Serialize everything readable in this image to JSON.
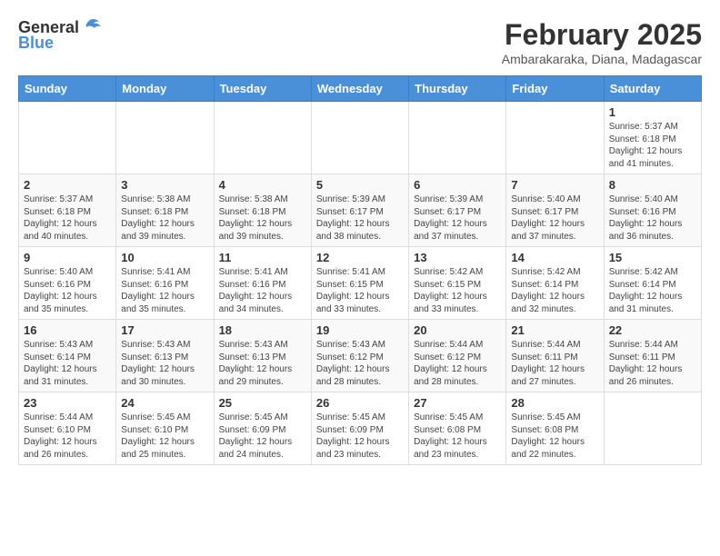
{
  "header": {
    "logo_general": "General",
    "logo_blue": "Blue",
    "month_title": "February 2025",
    "location": "Ambarakaraka, Diana, Madagascar"
  },
  "weekdays": [
    "Sunday",
    "Monday",
    "Tuesday",
    "Wednesday",
    "Thursday",
    "Friday",
    "Saturday"
  ],
  "weeks": [
    {
      "days": [
        {
          "num": "",
          "info": ""
        },
        {
          "num": "",
          "info": ""
        },
        {
          "num": "",
          "info": ""
        },
        {
          "num": "",
          "info": ""
        },
        {
          "num": "",
          "info": ""
        },
        {
          "num": "",
          "info": ""
        },
        {
          "num": "1",
          "info": "Sunrise: 5:37 AM\nSunset: 6:18 PM\nDaylight: 12 hours\nand 41 minutes."
        }
      ]
    },
    {
      "days": [
        {
          "num": "2",
          "info": "Sunrise: 5:37 AM\nSunset: 6:18 PM\nDaylight: 12 hours\nand 40 minutes."
        },
        {
          "num": "3",
          "info": "Sunrise: 5:38 AM\nSunset: 6:18 PM\nDaylight: 12 hours\nand 39 minutes."
        },
        {
          "num": "4",
          "info": "Sunrise: 5:38 AM\nSunset: 6:18 PM\nDaylight: 12 hours\nand 39 minutes."
        },
        {
          "num": "5",
          "info": "Sunrise: 5:39 AM\nSunset: 6:17 PM\nDaylight: 12 hours\nand 38 minutes."
        },
        {
          "num": "6",
          "info": "Sunrise: 5:39 AM\nSunset: 6:17 PM\nDaylight: 12 hours\nand 37 minutes."
        },
        {
          "num": "7",
          "info": "Sunrise: 5:40 AM\nSunset: 6:17 PM\nDaylight: 12 hours\nand 37 minutes."
        },
        {
          "num": "8",
          "info": "Sunrise: 5:40 AM\nSunset: 6:16 PM\nDaylight: 12 hours\nand 36 minutes."
        }
      ]
    },
    {
      "days": [
        {
          "num": "9",
          "info": "Sunrise: 5:40 AM\nSunset: 6:16 PM\nDaylight: 12 hours\nand 35 minutes."
        },
        {
          "num": "10",
          "info": "Sunrise: 5:41 AM\nSunset: 6:16 PM\nDaylight: 12 hours\nand 35 minutes."
        },
        {
          "num": "11",
          "info": "Sunrise: 5:41 AM\nSunset: 6:16 PM\nDaylight: 12 hours\nand 34 minutes."
        },
        {
          "num": "12",
          "info": "Sunrise: 5:41 AM\nSunset: 6:15 PM\nDaylight: 12 hours\nand 33 minutes."
        },
        {
          "num": "13",
          "info": "Sunrise: 5:42 AM\nSunset: 6:15 PM\nDaylight: 12 hours\nand 33 minutes."
        },
        {
          "num": "14",
          "info": "Sunrise: 5:42 AM\nSunset: 6:14 PM\nDaylight: 12 hours\nand 32 minutes."
        },
        {
          "num": "15",
          "info": "Sunrise: 5:42 AM\nSunset: 6:14 PM\nDaylight: 12 hours\nand 31 minutes."
        }
      ]
    },
    {
      "days": [
        {
          "num": "16",
          "info": "Sunrise: 5:43 AM\nSunset: 6:14 PM\nDaylight: 12 hours\nand 31 minutes."
        },
        {
          "num": "17",
          "info": "Sunrise: 5:43 AM\nSunset: 6:13 PM\nDaylight: 12 hours\nand 30 minutes."
        },
        {
          "num": "18",
          "info": "Sunrise: 5:43 AM\nSunset: 6:13 PM\nDaylight: 12 hours\nand 29 minutes."
        },
        {
          "num": "19",
          "info": "Sunrise: 5:43 AM\nSunset: 6:12 PM\nDaylight: 12 hours\nand 28 minutes."
        },
        {
          "num": "20",
          "info": "Sunrise: 5:44 AM\nSunset: 6:12 PM\nDaylight: 12 hours\nand 28 minutes."
        },
        {
          "num": "21",
          "info": "Sunrise: 5:44 AM\nSunset: 6:11 PM\nDaylight: 12 hours\nand 27 minutes."
        },
        {
          "num": "22",
          "info": "Sunrise: 5:44 AM\nSunset: 6:11 PM\nDaylight: 12 hours\nand 26 minutes."
        }
      ]
    },
    {
      "days": [
        {
          "num": "23",
          "info": "Sunrise: 5:44 AM\nSunset: 6:10 PM\nDaylight: 12 hours\nand 26 minutes."
        },
        {
          "num": "24",
          "info": "Sunrise: 5:45 AM\nSunset: 6:10 PM\nDaylight: 12 hours\nand 25 minutes."
        },
        {
          "num": "25",
          "info": "Sunrise: 5:45 AM\nSunset: 6:09 PM\nDaylight: 12 hours\nand 24 minutes."
        },
        {
          "num": "26",
          "info": "Sunrise: 5:45 AM\nSunset: 6:09 PM\nDaylight: 12 hours\nand 23 minutes."
        },
        {
          "num": "27",
          "info": "Sunrise: 5:45 AM\nSunset: 6:08 PM\nDaylight: 12 hours\nand 23 minutes."
        },
        {
          "num": "28",
          "info": "Sunrise: 5:45 AM\nSunset: 6:08 PM\nDaylight: 12 hours\nand 22 minutes."
        },
        {
          "num": "",
          "info": ""
        }
      ]
    }
  ]
}
